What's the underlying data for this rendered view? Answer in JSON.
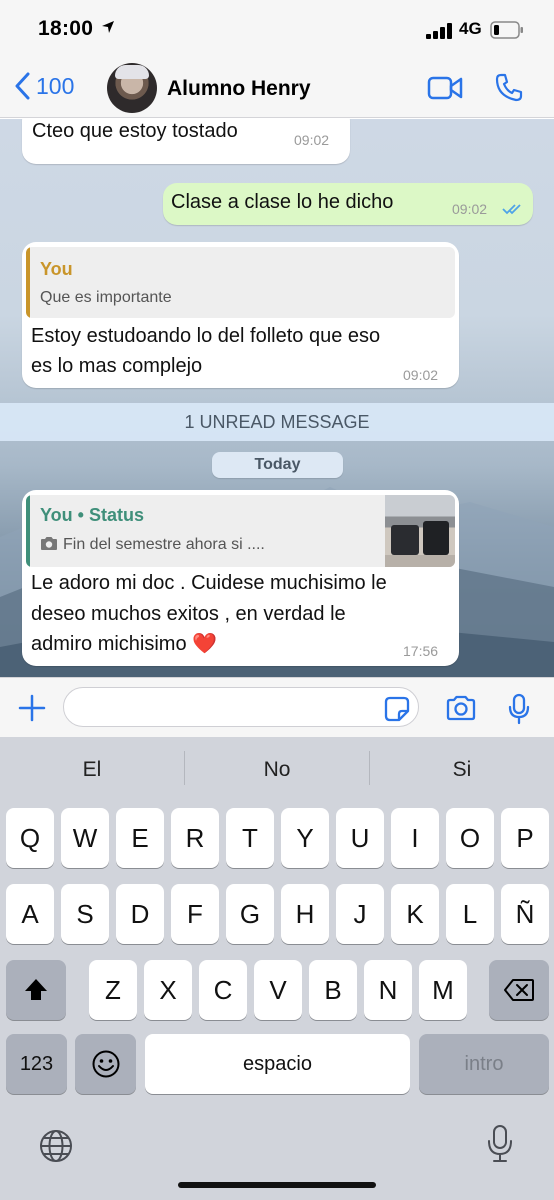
{
  "status_bar": {
    "time": "18:00",
    "network": "4G"
  },
  "header": {
    "back_count": "100",
    "contact_name": "Alumno Henry"
  },
  "messages": {
    "m1": {
      "text": "Cteo que estoy tostado",
      "time": "09:02"
    },
    "m2": {
      "text": "Clase a clase lo he dicho",
      "time": "09:02"
    },
    "m3": {
      "quote_author": "You",
      "quote_text": "Que es importante",
      "line1": "Estoy estudoando lo del folleto que eso",
      "line2": "es lo mas complejo",
      "time": "09:02"
    },
    "unread_label": "1 UNREAD MESSAGE",
    "date_label": "Today",
    "m4": {
      "quote_author": "You • Status",
      "quote_text": "Fin del semestre ahora si  ....",
      "line1": "Le adoro mi doc . Cuidese muchisimo le",
      "line2": "deseo muchos exitos , en verdad le",
      "line3": "admiro michisimo ❤️",
      "time": "17:56"
    }
  },
  "input": {
    "placeholder": ""
  },
  "keyboard": {
    "suggestions": [
      "El",
      "No",
      "Si"
    ],
    "row1": [
      "Q",
      "W",
      "E",
      "R",
      "T",
      "Y",
      "U",
      "I",
      "O",
      "P"
    ],
    "row2": [
      "A",
      "S",
      "D",
      "F",
      "G",
      "H",
      "J",
      "K",
      "L",
      "Ñ"
    ],
    "row3": [
      "Z",
      "X",
      "C",
      "V",
      "B",
      "N",
      "M"
    ],
    "numbers_key": "123",
    "space_key": "espacio",
    "return_key": "intro"
  },
  "colors": {
    "accent": "#2a74e8",
    "outgoing_bubble": "#dcf8c6",
    "quote_you": "#c9952a",
    "quote_status": "#3f8f7a",
    "read_ticks": "#4fa3e8"
  }
}
